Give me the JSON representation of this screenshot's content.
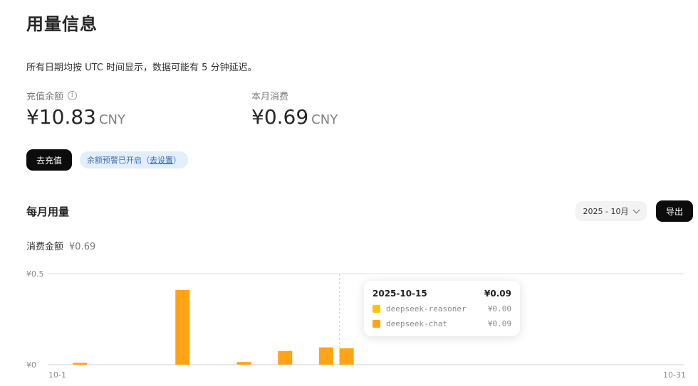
{
  "header": {
    "title": "用量信息"
  },
  "note": "所有日期均按 UTC 时间显示，数据可能有 5 分钟延迟。",
  "balance": {
    "label": "充值余额",
    "amount": "¥10.83",
    "currency": "CNY"
  },
  "monthly_spend": {
    "label": "本月消费",
    "amount": "¥0.69",
    "currency": "CNY"
  },
  "actions": {
    "recharge_label": "去充值",
    "alert_text": "余额预警已开启（",
    "alert_link": "去设置",
    "alert_suffix": "）"
  },
  "usage": {
    "title": "每月用量",
    "month": "2025 - 10月",
    "export_label": "导出",
    "total_label": "消费金额",
    "total_value": "¥0.69"
  },
  "colors": {
    "reasoner": "#ffc400",
    "chat": "#ffa317"
  },
  "tooltip": {
    "date": "2025-10-15",
    "total": "¥0.09",
    "rows": [
      {
        "name": "deepseek-reasoner",
        "value": "¥0.00"
      },
      {
        "name": "deepseek-chat",
        "value": "¥0.09"
      }
    ]
  },
  "chart_data": {
    "type": "bar",
    "x": [
      1,
      2,
      3,
      4,
      5,
      6,
      7,
      8,
      9,
      10,
      11,
      12,
      13,
      14,
      15,
      16,
      17,
      18,
      19,
      20,
      21,
      22,
      23,
      24,
      25,
      26,
      27,
      28,
      29,
      30,
      31
    ],
    "x_tick_labels": [
      "10-1",
      "10-31"
    ],
    "series": [
      {
        "name": "deepseek-reasoner",
        "values": [
          0,
          0,
          0,
          0,
          0,
          0,
          0,
          0,
          0,
          0,
          0,
          0,
          0,
          0,
          0,
          0,
          0,
          0,
          0,
          0,
          0,
          0,
          0,
          0,
          0,
          0,
          0,
          0,
          0,
          0,
          0
        ]
      },
      {
        "name": "deepseek-chat",
        "values": [
          0,
          0.01,
          0,
          0,
          0,
          0,
          0.41,
          0,
          0,
          0.015,
          0,
          0.075,
          0,
          0.095,
          0.09,
          0,
          0,
          0,
          0,
          0,
          0,
          0,
          0,
          0,
          0,
          0,
          0,
          0,
          0,
          0,
          0
        ]
      }
    ],
    "y_tick_labels": [
      "¥0",
      "¥0.5"
    ],
    "ylim": [
      0,
      0.5
    ],
    "highlight_x": 15,
    "grid": true,
    "stacked": true
  }
}
